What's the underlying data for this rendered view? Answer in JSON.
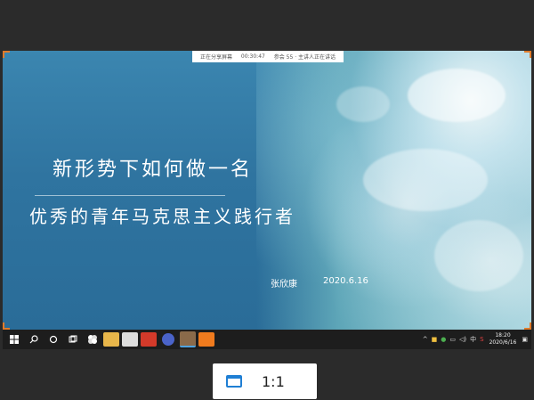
{
  "slide": {
    "info_items": [
      "正在分享屏幕",
      "00:30:47",
      "参会 55 · 主讲人正在讲话"
    ],
    "title_line1": "新形势下如何做一名",
    "title_line2": "优秀的青年马克思主义践行者",
    "author": "张欣康",
    "date": "2020.6.16"
  },
  "taskbar": {
    "icons": [
      "windows-start-icon",
      "search-icon",
      "cortana-icon",
      "task-view-icon",
      "pinwheel-app-icon",
      "file-explorer-icon",
      "store-icon",
      "office-app-icon",
      "browser-icon",
      "video-app-icon",
      "media-app-icon"
    ],
    "tray_lang": "中",
    "time": "18:20",
    "date": "2020/6/16"
  },
  "zoom": {
    "label": "1:1"
  },
  "colors": {
    "accent": "#1f7fd4",
    "corner": "#e07b2a",
    "slide_blue": "#2f74a0"
  }
}
